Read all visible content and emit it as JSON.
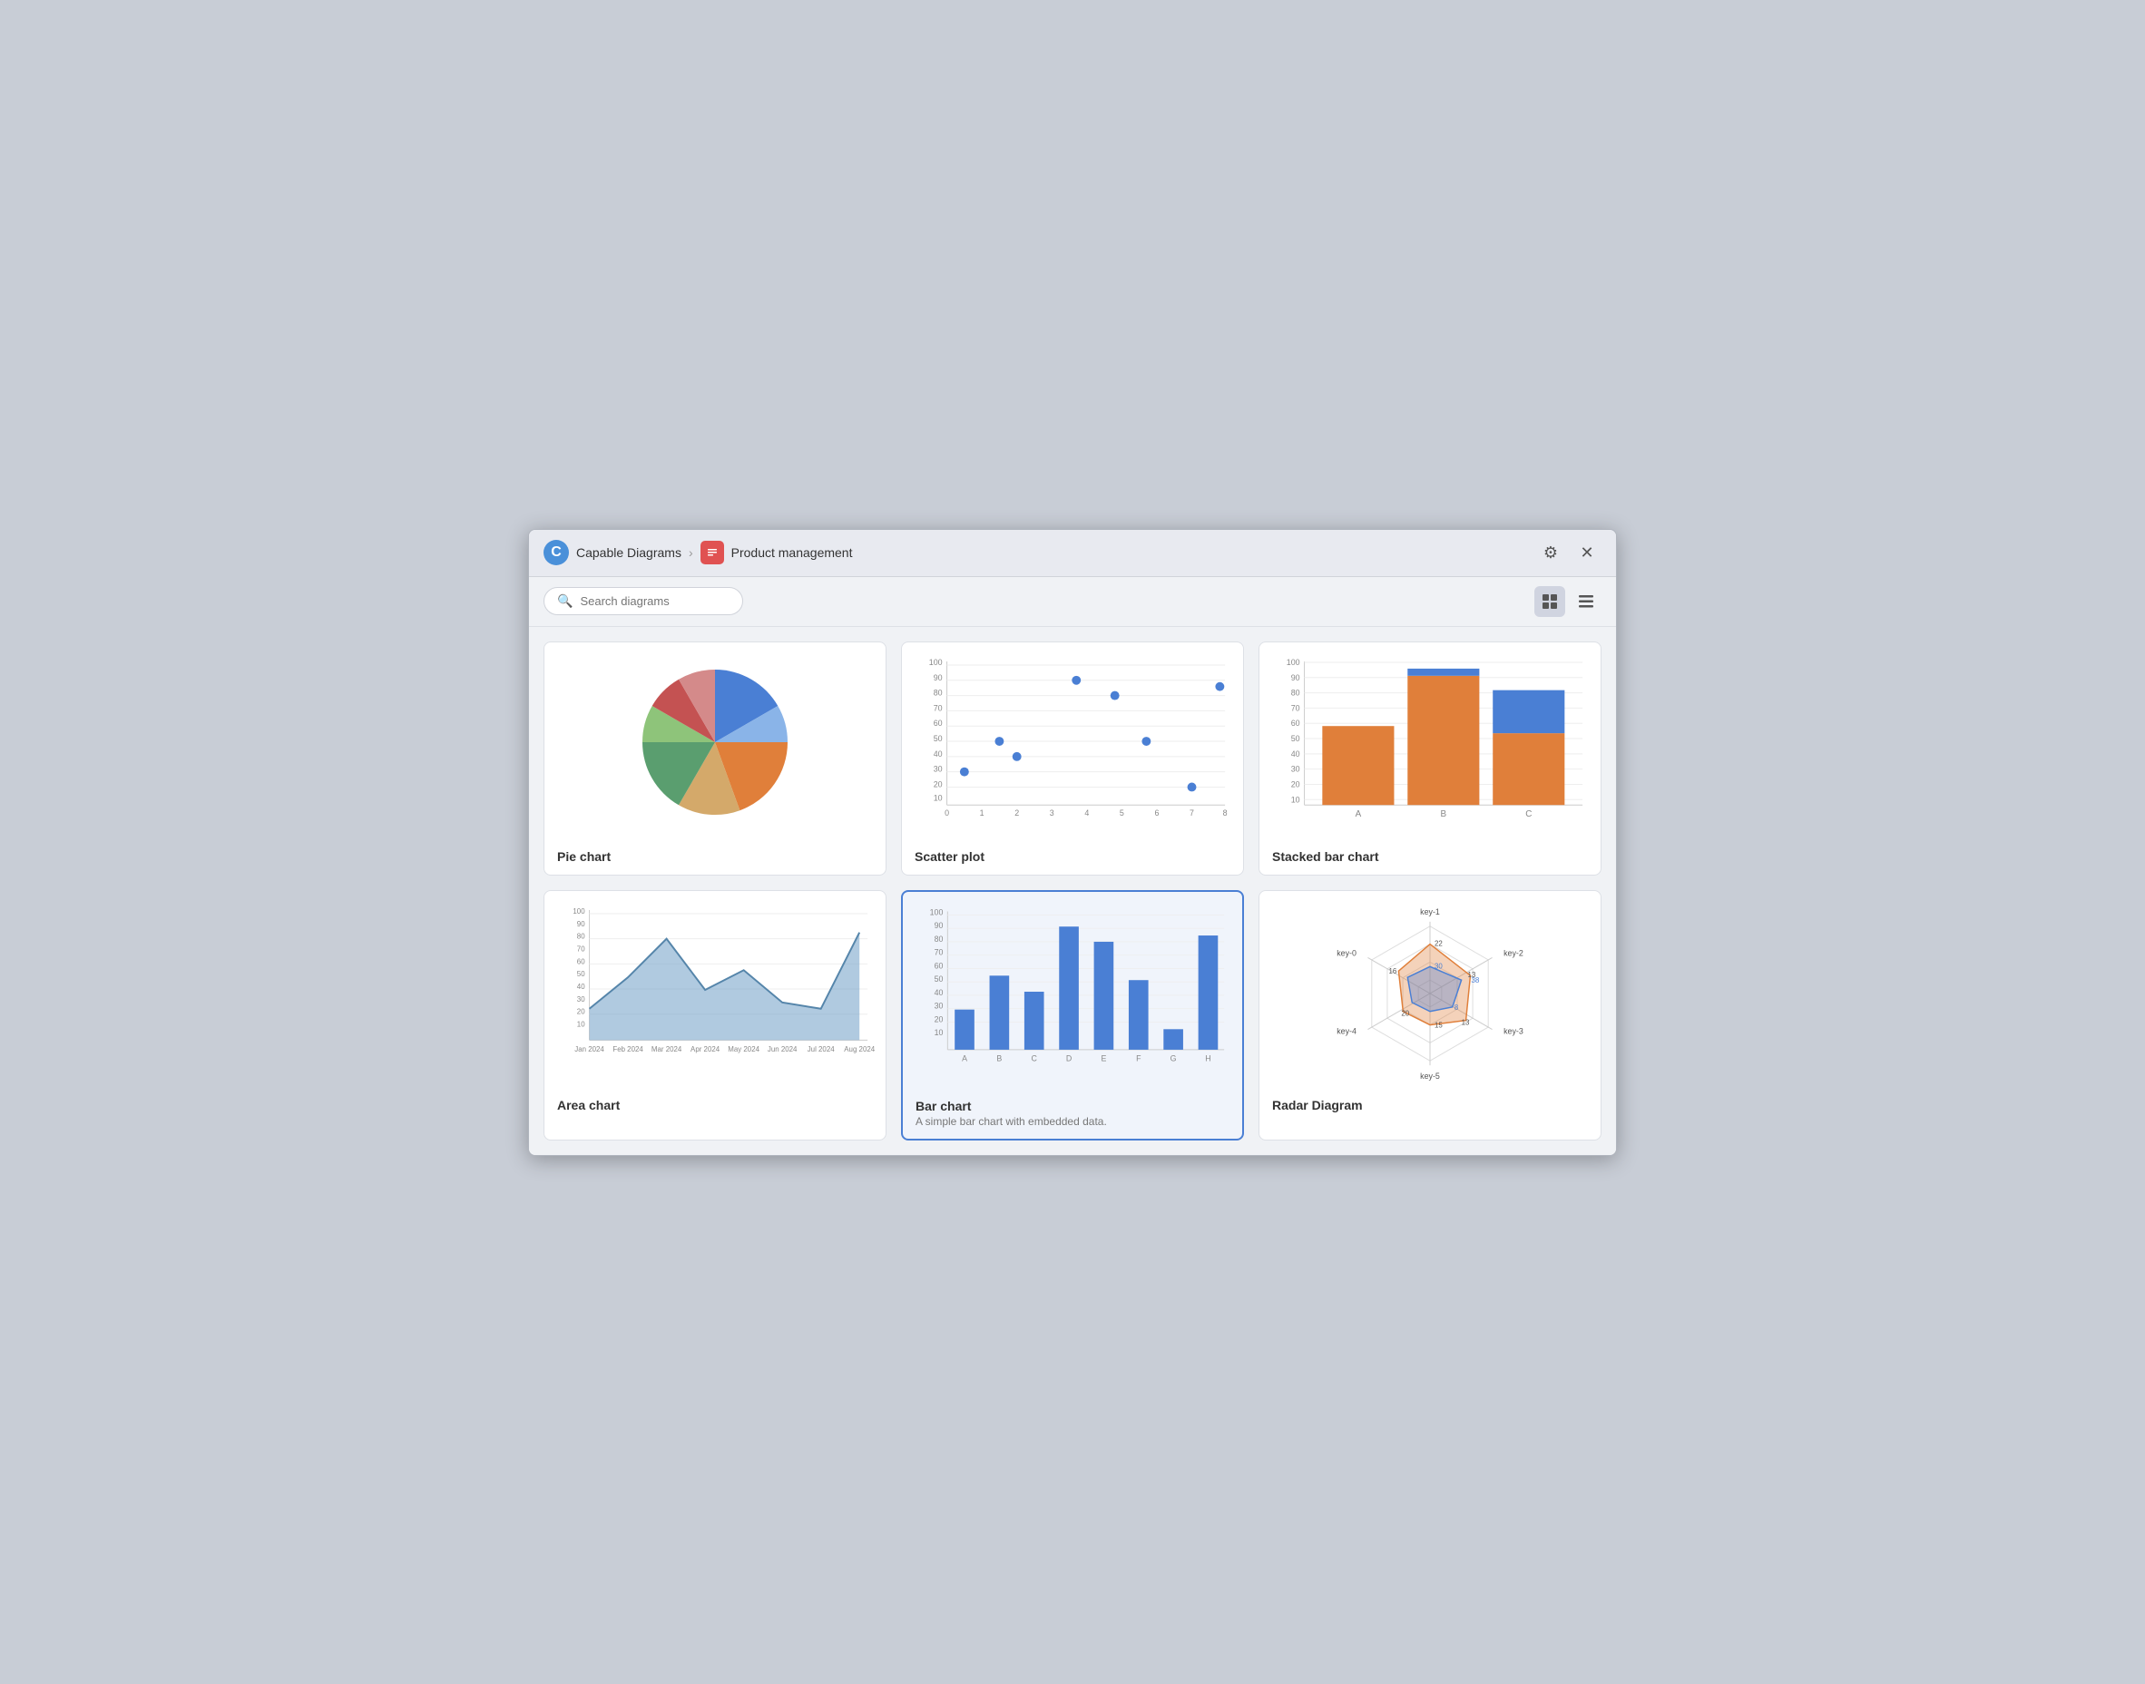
{
  "app": {
    "logo_letter": "C",
    "app_name": "Capable Diagrams",
    "chevron": "›",
    "page_icon": "📄",
    "page_name": "Product management",
    "gear_label": "⚙",
    "close_label": "✕"
  },
  "toolbar": {
    "search_placeholder": "Search diagrams",
    "grid_icon": "⊞",
    "list_icon": "☰"
  },
  "cards": [
    {
      "id": "pie-chart",
      "title": "Pie chart",
      "subtitle": "",
      "selected": false
    },
    {
      "id": "scatter-plot",
      "title": "Scatter plot",
      "subtitle": "",
      "selected": false
    },
    {
      "id": "stacked-bar-chart",
      "title": "Stacked bar chart",
      "subtitle": "",
      "selected": false
    },
    {
      "id": "area-chart",
      "title": "Area chart",
      "subtitle": "",
      "selected": false
    },
    {
      "id": "bar-chart",
      "title": "Bar chart",
      "subtitle": "A simple bar chart with embedded data.",
      "selected": true
    },
    {
      "id": "radar-diagram",
      "title": "Radar Diagram",
      "subtitle": "",
      "selected": false
    }
  ]
}
